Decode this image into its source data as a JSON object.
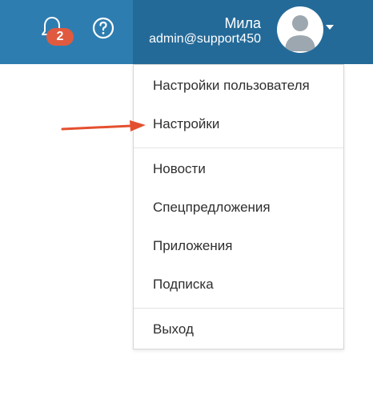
{
  "header": {
    "notifications": {
      "icon": "bell-icon",
      "count": "2"
    },
    "help": {
      "icon": "question-circle-icon"
    },
    "user": {
      "name": "Мила",
      "email": "admin@support450",
      "avatar_icon": "user-avatar-icon",
      "caret_icon": "caret-down-icon"
    }
  },
  "menu": {
    "items": [
      {
        "label": "Настройки пользователя"
      },
      {
        "label": "Настройки"
      },
      {
        "label": "Новости"
      },
      {
        "label": "Спецпредложения"
      },
      {
        "label": "Приложения"
      },
      {
        "label": "Подписка"
      },
      {
        "label": "Выход"
      }
    ]
  },
  "annotation": {
    "arrow_icon": "arrow-right-icon",
    "color": "#e4502f"
  },
  "colors": {
    "header_bg": "#2e7db1",
    "user_block_bg": "#246a98",
    "badge_bg": "#e05a3f",
    "menu_text": "#2f2f2f"
  }
}
